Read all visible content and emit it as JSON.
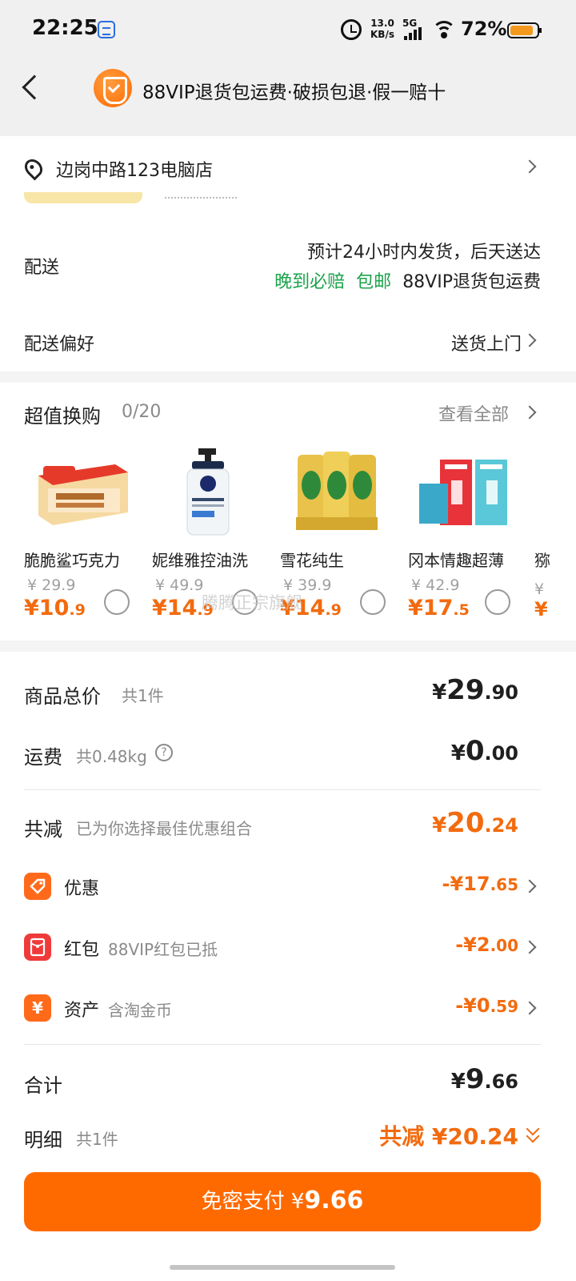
{
  "status": {
    "time": "22:25",
    "net_speed_top": "13.0",
    "net_speed_bottom": "KB/s",
    "network": "5G",
    "battery": "72%"
  },
  "header": {
    "title": "88VIP退货包运费·破损包退·假一赔十"
  },
  "address": {
    "text": "边岗中路123电脑店"
  },
  "delivery": {
    "label": "配送",
    "line1": "预计24小时内发货，后天送达",
    "tag_late": "晚到必赔",
    "tag_free": "包邮",
    "tag_vip": "88VIP退货包运费",
    "pref_label": "配送偏好",
    "pref_value": "送货上门"
  },
  "exchange": {
    "title": "超值换购",
    "count": "0/20",
    "view_all": "查看全部",
    "watermark": "腾腾正宗旗舰",
    "products": [
      {
        "name": "脆脆鲨巧克力",
        "old_price": "¥ 29.9",
        "price_int": "¥10",
        "price_dec": ".9",
        "icon": "wafer-box-icon"
      },
      {
        "name": "妮维雅控油洗",
        "old_price": "¥ 49.9",
        "price_int": "¥14",
        "price_dec": ".9",
        "icon": "nivea-bottle-icon"
      },
      {
        "name": "雪花纯生",
        "old_price": "¥ 39.9",
        "price_int": "¥14",
        "price_dec": ".9",
        "icon": "beer-cans-icon"
      },
      {
        "name": "冈本情趣超薄",
        "old_price": "¥ 42.9",
        "price_int": "¥17",
        "price_dec": ".5",
        "icon": "okamoto-box-icon"
      }
    ],
    "partial_name": "猕",
    "partial_old": "¥",
    "partial_new": "¥"
  },
  "summary": {
    "goods_label": "商品总价",
    "goods_sub": "共1件",
    "goods_y": "¥",
    "goods_int": "29",
    "goods_dec": ".90",
    "ship_label": "运费",
    "ship_sub": "共0.48kg",
    "ship_help": "?",
    "ship_y": "¥",
    "ship_int": "0",
    "ship_dec": ".00",
    "reduce_label": "共减",
    "reduce_sub": "已为你选择最佳优惠组合",
    "reduce_y": "¥",
    "reduce_int": "20",
    "reduce_dec": ".24",
    "discount_label": "优惠",
    "discount_int": "-¥17",
    "discount_dec": ".65",
    "redpack_label": "红包",
    "redpack_sub": "88VIP红包已抵",
    "redpack_int": "-¥2",
    "redpack_dec": ".00",
    "asset_label": "资产",
    "asset_sub": "含淘金币",
    "asset_icon_char": "¥",
    "asset_int": "-¥0",
    "asset_dec": ".59",
    "total_label": "合计",
    "total_y": "¥",
    "total_int": "9",
    "total_dec": ".66",
    "detail_label": "明细",
    "detail_sub": "共1件",
    "detail_reduce": "共减 ¥20.24"
  },
  "pay": {
    "label": "免密支付 ¥",
    "amount": "9.66"
  },
  "colors": {
    "accent": "#ff6a00",
    "price": "#f26b0f",
    "green": "#1aa34a"
  }
}
